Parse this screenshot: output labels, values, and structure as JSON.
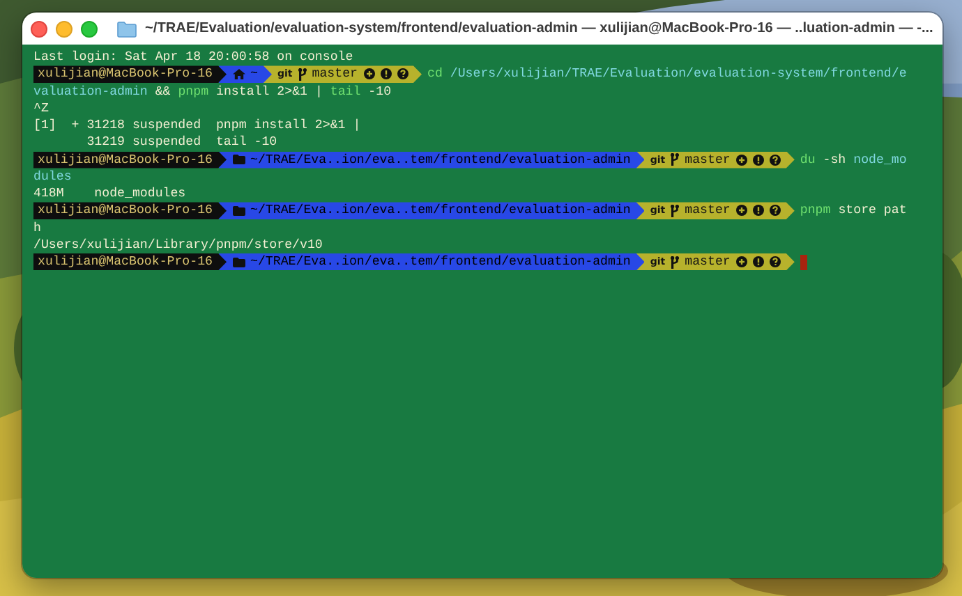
{
  "window": {
    "title": "~/TRAE/Evaluation/evaluation-system/frontend/evaluation-admin — xulijian@MacBook-Pro-16 — ..luation-admin — -..."
  },
  "terminal": {
    "lines": [
      {
        "kind": "output",
        "segments": [
          {
            "kind": "plain",
            "text": "Last login: Sat Apr 18 20:00:58 on console"
          }
        ]
      },
      {
        "kind": "prompt",
        "user": "xulijian@MacBook-Pro-16",
        "dir": {
          "kind": "home",
          "text": "~"
        },
        "vcs": "git",
        "branch": "master",
        "command": [
          {
            "kind": "cmd",
            "text": "cd"
          },
          {
            "kind": "path",
            "text": " /Users/xulijian/TRAE/Evaluation/evaluation-system/frontend/e"
          }
        ],
        "cursor": false
      },
      {
        "kind": "output",
        "segments": [
          {
            "kind": "path",
            "text": "valuation-admin"
          },
          {
            "kind": "plain",
            "text": " && "
          },
          {
            "kind": "cmd",
            "text": "pnpm"
          },
          {
            "kind": "plain",
            "text": " install 2>&1 | "
          },
          {
            "kind": "cmd",
            "text": "tail"
          },
          {
            "kind": "plain",
            "text": " -10"
          }
        ]
      },
      {
        "kind": "output",
        "segments": [
          {
            "kind": "plain",
            "text": "^Z"
          }
        ]
      },
      {
        "kind": "output",
        "segments": [
          {
            "kind": "plain",
            "text": "[1]  + 31218 suspended  pnpm install 2>&1 |"
          }
        ]
      },
      {
        "kind": "output",
        "segments": [
          {
            "kind": "plain",
            "text": "       31219 suspended  tail -10"
          }
        ]
      },
      {
        "kind": "prompt",
        "user": "xulijian@MacBook-Pro-16",
        "dir": {
          "kind": "folder",
          "text": "~/TRAE/Eva..ion/eva..tem/frontend/evaluation-admin"
        },
        "vcs": "git",
        "branch": "master",
        "command": [
          {
            "kind": "cmd",
            "text": "du"
          },
          {
            "kind": "plain",
            "text": " -sh "
          },
          {
            "kind": "path",
            "text": "node_mo"
          }
        ],
        "cursor": false
      },
      {
        "kind": "output",
        "segments": [
          {
            "kind": "path",
            "text": "dules"
          }
        ]
      },
      {
        "kind": "output",
        "segments": [
          {
            "kind": "plain",
            "text": "418M    node_modules"
          }
        ]
      },
      {
        "kind": "prompt",
        "user": "xulijian@MacBook-Pro-16",
        "dir": {
          "kind": "folder",
          "text": "~/TRAE/Eva..ion/eva..tem/frontend/evaluation-admin"
        },
        "vcs": "git",
        "branch": "master",
        "command": [
          {
            "kind": "cmd",
            "text": "pnpm"
          },
          {
            "kind": "plain",
            "text": " store pat"
          }
        ],
        "cursor": false
      },
      {
        "kind": "output",
        "segments": [
          {
            "kind": "plain",
            "text": "h"
          }
        ]
      },
      {
        "kind": "output",
        "segments": [
          {
            "kind": "plain",
            "text": "/Users/xulijian/Library/pnpm/store/v10"
          }
        ]
      },
      {
        "kind": "prompt",
        "user": "xulijian@MacBook-Pro-16",
        "dir": {
          "kind": "folder",
          "text": "~/TRAE/Eva..ion/eva..tem/frontend/evaluation-admin"
        },
        "vcs": "git",
        "branch": "master",
        "cursor": true
      }
    ]
  }
}
